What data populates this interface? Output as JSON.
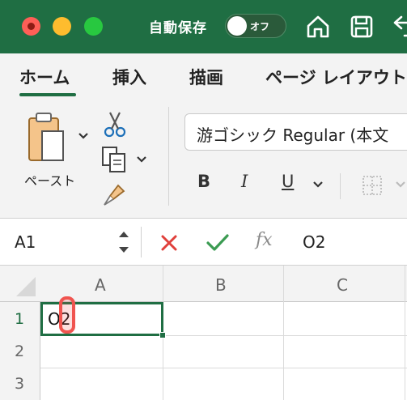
{
  "titlebar": {
    "autosave_label": "自動保存",
    "autosave_toggle": "オフ",
    "colors": {
      "bar": "#1f6e43"
    },
    "icons": [
      "home-icon",
      "save-icon",
      "undo-icon"
    ]
  },
  "tabs": [
    {
      "label": "ホーム",
      "active": true
    },
    {
      "label": "挿入"
    },
    {
      "label": "描画"
    },
    {
      "label": "ページ レイアウト"
    }
  ],
  "clipboard": {
    "paste_label": "ペースト"
  },
  "font": {
    "name": "游ゴシック Regular (本文"
  },
  "format": {
    "bold": "B",
    "italic": "I",
    "underline": "U"
  },
  "formula_bar": {
    "name_box": "A1",
    "fx": "fx",
    "content": "O2"
  },
  "grid": {
    "columns": [
      "A",
      "B",
      "C"
    ],
    "rows": [
      "1",
      "2",
      "3"
    ],
    "active_cell": {
      "ref": "A1",
      "value": "O2"
    }
  }
}
